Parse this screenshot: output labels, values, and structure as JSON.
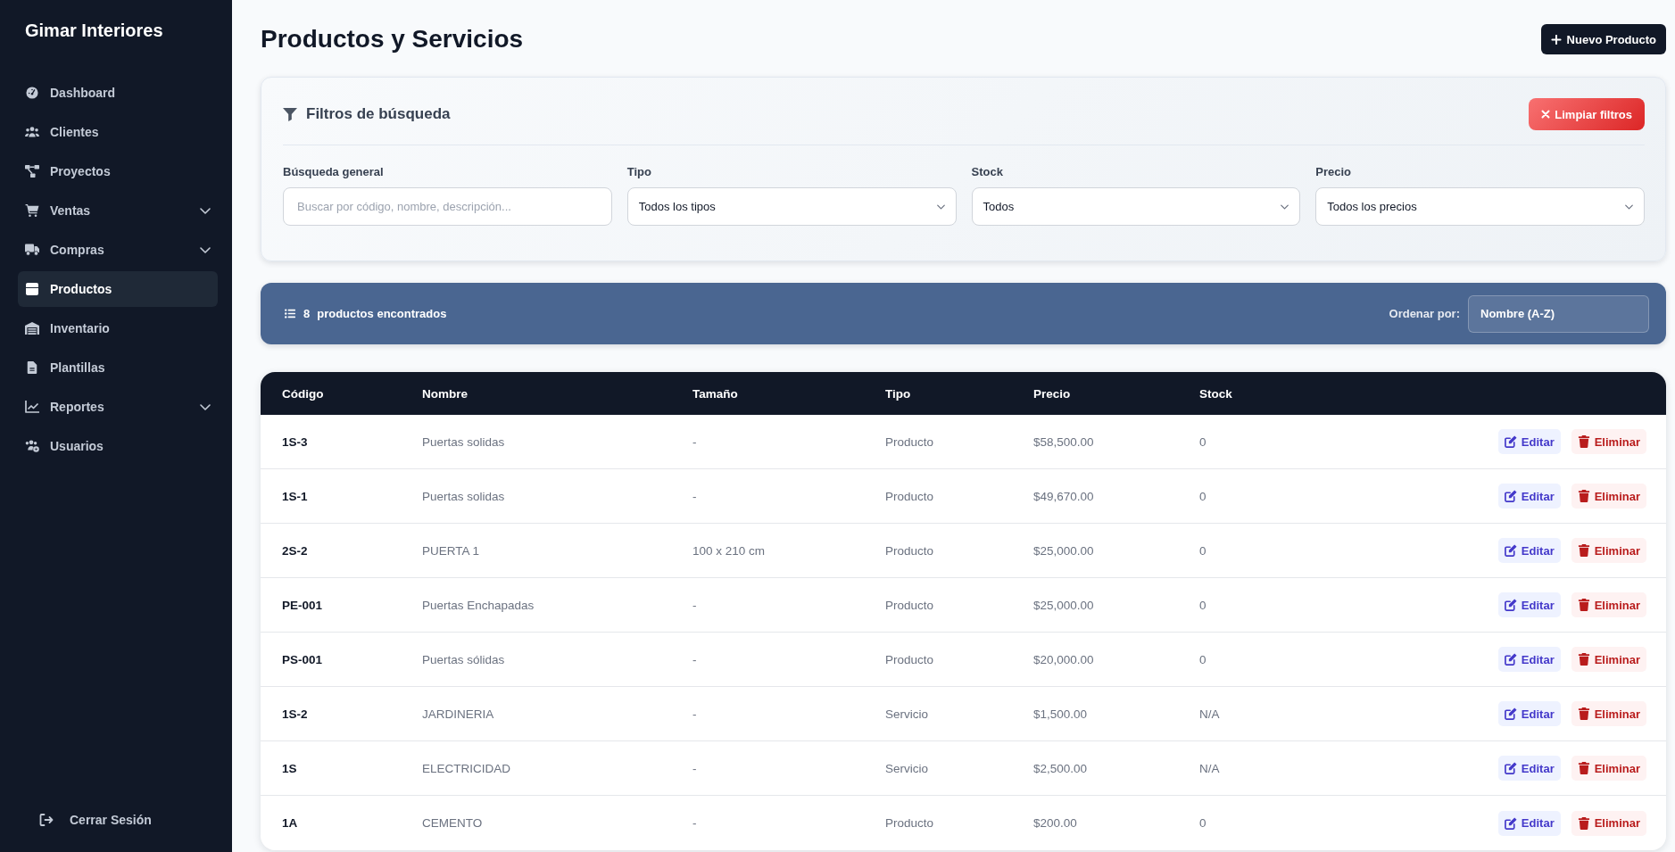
{
  "sidebar": {
    "brand": "Gimar Interiores",
    "items": [
      {
        "label": "Dashboard",
        "selected": false,
        "has_submenu": false
      },
      {
        "label": "Clientes",
        "selected": false,
        "has_submenu": false
      },
      {
        "label": "Proyectos",
        "selected": false,
        "has_submenu": false
      },
      {
        "label": "Ventas",
        "selected": false,
        "has_submenu": true
      },
      {
        "label": "Compras",
        "selected": false,
        "has_submenu": true
      },
      {
        "label": "Productos",
        "selected": true,
        "has_submenu": false
      },
      {
        "label": "Inventario",
        "selected": false,
        "has_submenu": false
      },
      {
        "label": "Plantillas",
        "selected": false,
        "has_submenu": false
      },
      {
        "label": "Reportes",
        "selected": false,
        "has_submenu": true
      },
      {
        "label": "Usuarios",
        "selected": false,
        "has_submenu": false
      }
    ],
    "logout": "Cerrar Sesión"
  },
  "header": {
    "title": "Productos y Servicios",
    "new_button": "Nuevo Producto"
  },
  "filters": {
    "title": "Filtros de búsqueda",
    "clear_button": "Limpiar filtros",
    "fields": [
      {
        "kind": "text",
        "label": "Búsqueda general",
        "placeholder": "Buscar por código, nombre, descripción..."
      },
      {
        "kind": "select",
        "label": "Tipo",
        "value": "Todos los tipos"
      },
      {
        "kind": "select",
        "label": "Stock",
        "value": "Todos"
      },
      {
        "kind": "select",
        "label": "Precio",
        "value": "Todos los precios"
      }
    ]
  },
  "results": {
    "count": "8",
    "label": "productos encontrados",
    "sort_label": "Ordenar por:",
    "sort_value": "Nombre (A-Z)"
  },
  "table": {
    "columns": [
      "Código",
      "Nombre",
      "Tamaño",
      "Tipo",
      "Precio",
      "Stock"
    ],
    "rows": [
      {
        "cells": [
          "1S-3",
          "Puertas solidas",
          "-",
          "Producto",
          "$58,500.00",
          "0"
        ],
        "actions": [
          {
            "kind": "edit",
            "label": "Editar"
          },
          {
            "kind": "delete",
            "label": "Eliminar"
          }
        ]
      },
      {
        "cells": [
          "1S-1",
          "Puertas solidas",
          "-",
          "Producto",
          "$49,670.00",
          "0"
        ],
        "actions": [
          {
            "kind": "edit",
            "label": "Editar"
          },
          {
            "kind": "delete",
            "label": "Eliminar"
          }
        ]
      },
      {
        "cells": [
          "2S-2",
          "PUERTA 1",
          "100 x 210 cm",
          "Producto",
          "$25,000.00",
          "0"
        ],
        "actions": [
          {
            "kind": "edit",
            "label": "Editar"
          },
          {
            "kind": "delete",
            "label": "Eliminar"
          }
        ]
      },
      {
        "cells": [
          "PE-001",
          "Puertas Enchapadas",
          "-",
          "Producto",
          "$25,000.00",
          "0"
        ],
        "actions": [
          {
            "kind": "edit",
            "label": "Editar"
          },
          {
            "kind": "delete",
            "label": "Eliminar"
          }
        ]
      },
      {
        "cells": [
          "PS-001",
          "Puertas sólidas",
          "-",
          "Producto",
          "$20,000.00",
          "0"
        ],
        "actions": [
          {
            "kind": "edit",
            "label": "Editar"
          },
          {
            "kind": "delete",
            "label": "Eliminar"
          }
        ]
      },
      {
        "cells": [
          "1S-2",
          "JARDINERIA",
          "-",
          "Servicio",
          "$1,500.00",
          "N/A"
        ],
        "actions": [
          {
            "kind": "edit",
            "label": "Editar"
          },
          {
            "kind": "delete",
            "label": "Eliminar"
          }
        ]
      },
      {
        "cells": [
          "1S",
          "ELECTRICIDAD",
          "-",
          "Servicio",
          "$2,500.00",
          "N/A"
        ],
        "actions": [
          {
            "kind": "edit",
            "label": "Editar"
          },
          {
            "kind": "delete",
            "label": "Eliminar"
          }
        ]
      },
      {
        "cells": [
          "1A",
          "CEMENTO",
          "-",
          "Producto",
          "$200.00",
          "0"
        ],
        "actions": [
          {
            "kind": "edit",
            "label": "Editar"
          },
          {
            "kind": "delete",
            "label": "Eliminar"
          }
        ]
      }
    ]
  }
}
